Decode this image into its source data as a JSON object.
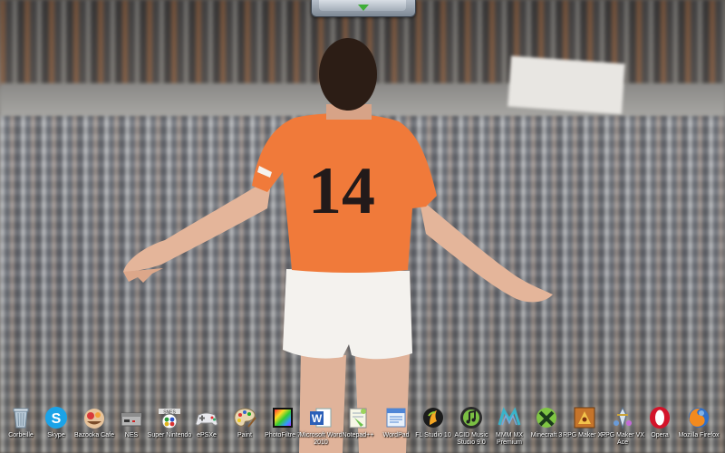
{
  "top_tab": {
    "icon": "chevron-down-icon"
  },
  "wallpaper": {
    "jersey_number": "14",
    "jersey_color": "#f07a3a",
    "shorts_color": "#f4f2ee"
  },
  "dock": {
    "items": [
      {
        "label": "Corbeille",
        "icon": "trash-icon"
      },
      {
        "label": "Skype",
        "icon": "skype-icon"
      },
      {
        "label": "Bazooka Cafe",
        "icon": "bazooka-cafe-icon"
      },
      {
        "label": "NES",
        "icon": "nes-console-icon"
      },
      {
        "label": "Super Nintendo",
        "icon": "super-nintendo-icon"
      },
      {
        "label": "ePSXe",
        "icon": "gamepad-icon"
      },
      {
        "label": "Paint",
        "icon": "paint-palette-icon"
      },
      {
        "label": "PhotoFiltre 7",
        "icon": "photofiltre-icon"
      },
      {
        "label": "Microsoft Word 2010",
        "icon": "word-icon"
      },
      {
        "label": "Notepad++",
        "icon": "notepad-plus-icon"
      },
      {
        "label": "WordPad",
        "icon": "wordpad-icon"
      },
      {
        "label": "FL Studio 10",
        "icon": "fl-studio-icon"
      },
      {
        "label": "ACID Music Studio 9.0",
        "icon": "acid-music-icon"
      },
      {
        "label": "MMM MX Premium",
        "icon": "mmm-mx-icon"
      },
      {
        "label": "Minecraft 3",
        "icon": "minecraft-icon"
      },
      {
        "label": "RPG Maker XP",
        "icon": "rpg-maker-xp-icon"
      },
      {
        "label": "RPG Maker VX Ace",
        "icon": "rpg-maker-vx-icon"
      },
      {
        "label": "Opera",
        "icon": "opera-icon"
      },
      {
        "label": "Mozilla Firefox",
        "icon": "firefox-icon"
      }
    ]
  }
}
